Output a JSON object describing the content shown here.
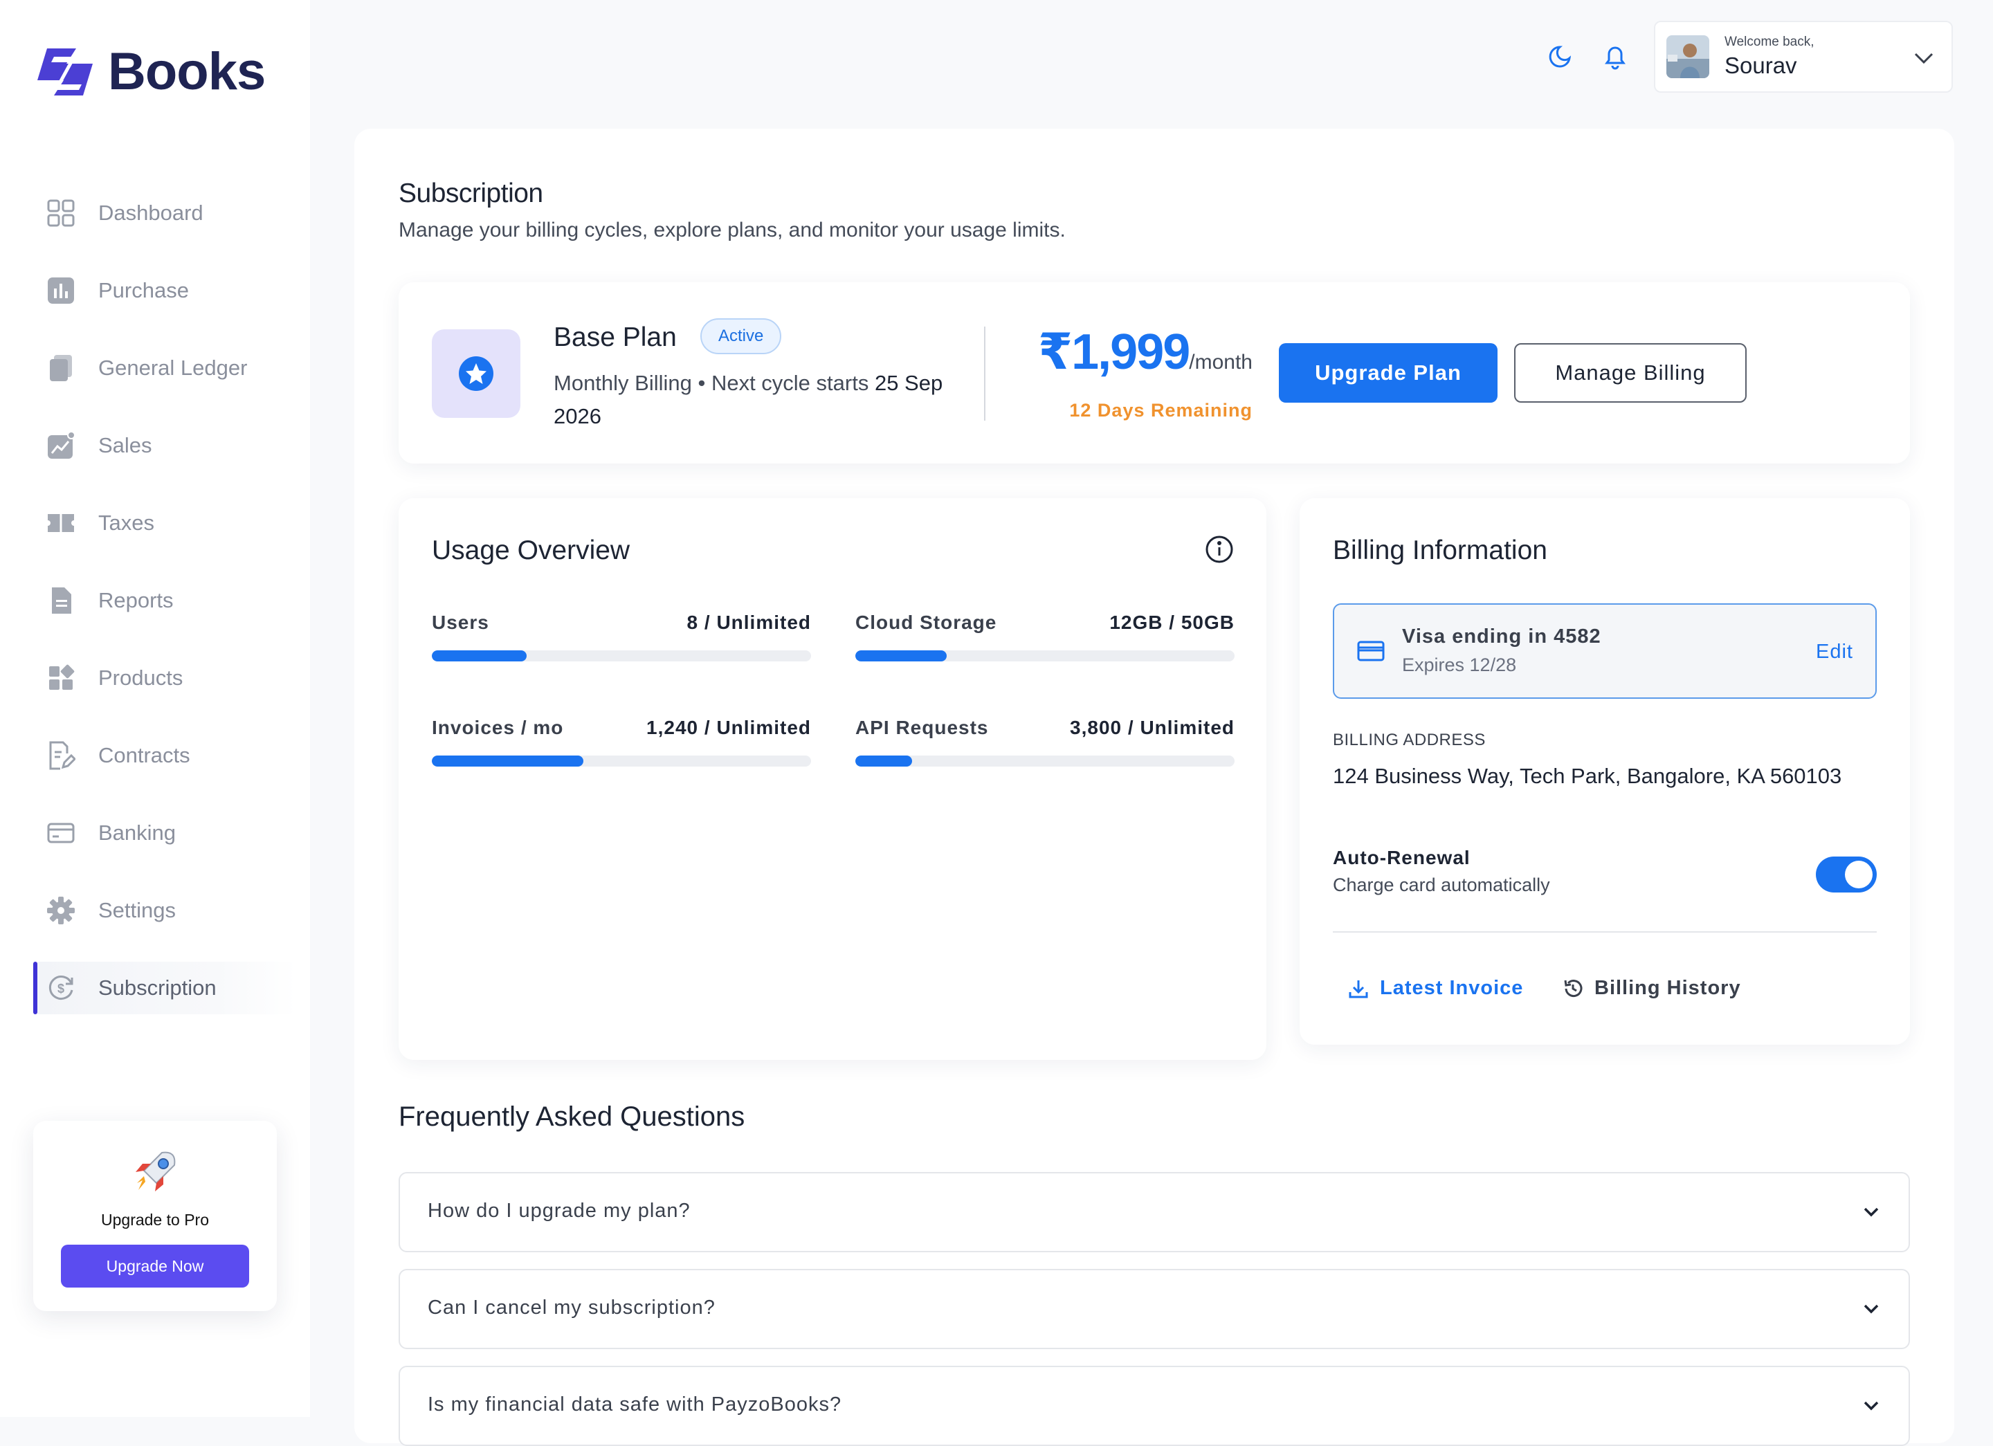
{
  "brand": {
    "name": "Books",
    "mark": "Z"
  },
  "sidebar": {
    "items": [
      {
        "label": "Dashboard",
        "icon": "dashboard-grid-icon"
      },
      {
        "label": "Purchase",
        "icon": "bar-chart-icon"
      },
      {
        "label": "General Ledger",
        "icon": "ledger-book-icon"
      },
      {
        "label": "Sales",
        "icon": "sales-trend-icon"
      },
      {
        "label": "Taxes",
        "icon": "tax-ticket-icon"
      },
      {
        "label": "Reports",
        "icon": "report-file-icon"
      },
      {
        "label": "Products",
        "icon": "products-blocks-icon"
      },
      {
        "label": "Contracts",
        "icon": "contract-edit-icon"
      },
      {
        "label": "Banking",
        "icon": "bank-card-icon"
      },
      {
        "label": "Settings",
        "icon": "settings-gear-icon"
      },
      {
        "label": "Subscription",
        "icon": "subscription-dollar-icon",
        "active": true
      }
    ],
    "promo": {
      "title": "Upgrade to Pro",
      "button": "Upgrade Now",
      "icon": "rocket-icon"
    }
  },
  "header": {
    "welcome": "Welcome back,",
    "user_name": "Sourav",
    "icons": [
      "moon-icon",
      "bell-icon",
      "chevron-down-icon"
    ]
  },
  "page": {
    "title": "Subscription",
    "subtitle": "Manage your billing cycles, explore plans, and monitor your usage limits."
  },
  "plan": {
    "name": "Base Plan",
    "status": "Active",
    "billing_prefix": "Monthly Billing • Next cycle starts",
    "next_date": "25 Sep 2026",
    "price": "₹1,999",
    "price_unit": "/month",
    "remaining": "12 Days Remaining",
    "upgrade_label": "Upgrade Plan",
    "manage_label": "Manage Billing"
  },
  "usage": {
    "title": "Usage Overview",
    "metrics": [
      {
        "label": "Users",
        "value": "8 / Unlimited",
        "fill": 0.25
      },
      {
        "label": "Cloud Storage",
        "value": "12GB / 50GB",
        "fill": 0.24
      },
      {
        "label": "Invoices / mo",
        "value": "1,240 / Unlimited",
        "fill": 0.4
      },
      {
        "label": "API Requests",
        "value": "3,800 / Unlimited",
        "fill": 0.15
      }
    ]
  },
  "billing": {
    "title": "Billing Information",
    "card_line": "Visa ending in 4582",
    "card_expiry": "Expires 12/28",
    "edit_label": "Edit",
    "address_label": "BILLING ADDRESS",
    "address": "124 Business Way, Tech Park, Bangalore, KA 560103",
    "auto_renew_title": "Auto-Renewal",
    "auto_renew_sub": "Charge card automatically",
    "auto_renew_on": true,
    "latest_invoice": "Latest Invoice",
    "billing_history": "Billing History"
  },
  "faq": {
    "title": "Frequently Asked Questions",
    "items": [
      "How do I upgrade my plan?",
      "Can I cancel my subscription?",
      "Is my financial data safe with PayzoBooks?"
    ]
  },
  "colors": {
    "accent": "#1a73f0",
    "brand": "#3f33d6",
    "warning": "#f0922e",
    "promo": "#5b4cf0"
  }
}
